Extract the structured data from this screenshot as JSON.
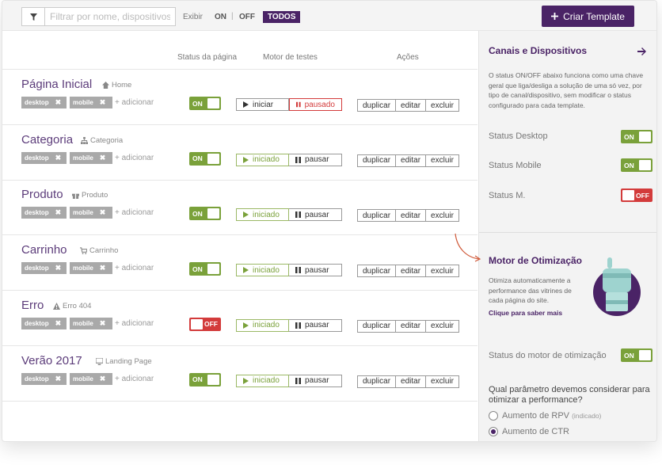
{
  "toolbar": {
    "filter_placeholder": "Filtrar por nome, dispositivos...",
    "exibir_label": "Exibir",
    "on_label": "ON",
    "off_label": "OFF",
    "separator": "|",
    "todos_label": "TODOS",
    "create_label": "Criar Template",
    "create_icon": "plus-icon"
  },
  "columns": {
    "status": "Status da página",
    "motor": "Motor de testes",
    "acoes": "Ações"
  },
  "rows": [
    {
      "title": "Página Inicial",
      "type": "Home",
      "icon": "home-icon",
      "tags": [
        "desktop",
        "mobile"
      ],
      "add": "+ adicionar",
      "status": "ON",
      "motor_start": "iniciar",
      "motor_pause": "pausado",
      "state": "paused"
    },
    {
      "title": "Categoria",
      "type": "Categoria",
      "icon": "sitemap-icon",
      "tags": [
        "desktop",
        "mobile"
      ],
      "add": "+ adicionar",
      "status": "ON",
      "motor_start": "iniciado",
      "motor_pause": "pausar",
      "state": "started"
    },
    {
      "title": "Produto",
      "type": "Produto",
      "icon": "gift-icon",
      "tags": [
        "desktop",
        "mobile"
      ],
      "add": "+ adicionar",
      "status": "ON",
      "motor_start": "iniciado",
      "motor_pause": "pausar",
      "state": "started"
    },
    {
      "title": "Carrinho",
      "type": "Carrinho",
      "icon": "cart-icon",
      "tags": [
        "desktop",
        "mobile"
      ],
      "add": "+ adicionar",
      "status": "ON",
      "motor_start": "iniciado",
      "motor_pause": "pausar",
      "state": "started"
    },
    {
      "title": "Erro",
      "type": "Erro 404",
      "icon": "warning-icon",
      "tags": [
        "desktop",
        "mobile"
      ],
      "add": "+ adicionar",
      "status": "OFF",
      "motor_start": "iniciado",
      "motor_pause": "pausar",
      "state": "started"
    },
    {
      "title": "Verão 2017",
      "type": "Landing Page",
      "icon": "monitor-icon",
      "tags": [
        "desktop",
        "mobile"
      ],
      "add": "+ adicionar",
      "status": "ON",
      "motor_start": "iniciado",
      "motor_pause": "pausar",
      "state": "started"
    }
  ],
  "actions": {
    "duplicar": "duplicar",
    "editar": "editar",
    "excluir": "excluir"
  },
  "sidebar": {
    "title": "Canais e Dispositivos",
    "description": "O status ON/OFF abaixo funciona como uma chave geral que liga/desliga a solução de uma só vez, por tipo de canal/dispositivo, sem modificar o status configurado para cada template.",
    "status_desktop_label": "Status Desktop",
    "status_desktop": "ON",
    "status_mobile_label": "Status Mobile",
    "status_mobile": "ON",
    "status_m_label": "Status M.",
    "status_m": "OFF",
    "motor_title": "Motor de Otimização",
    "motor_text": "Otimiza automaticamente a performance das vitrines de cada página do site.",
    "motor_link": "Clique para saber mais",
    "motor_status_label": "Status do motor de otimização",
    "motor_status": "ON",
    "question": "Qual parâmetro devemos considerar para otimizar a performance?",
    "option1": "Aumento de RPV",
    "option1_note": "(indicado)",
    "option2": "Aumento de CTR",
    "selected": "option2"
  },
  "colors": {
    "brand": "#4a2366",
    "title_purple": "#5c3c7a",
    "green": "#7aa13a",
    "red": "#d33b3b",
    "tag_gray": "#a9a9a9"
  }
}
